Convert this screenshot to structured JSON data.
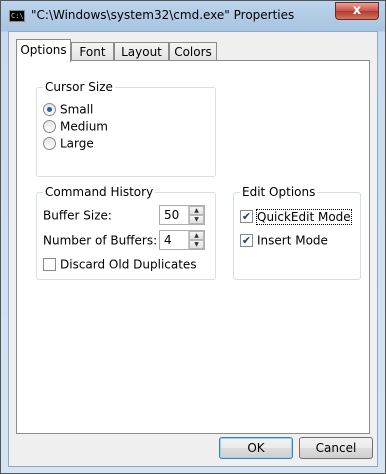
{
  "window": {
    "title": "\"C:\\Windows\\system32\\cmd.exe\" Properties",
    "app_icon_text": "C:\\",
    "close_glyph": "x"
  },
  "tabs": [
    {
      "label": "Options",
      "active": true
    },
    {
      "label": "Font",
      "active": false
    },
    {
      "label": "Layout",
      "active": false
    },
    {
      "label": "Colors",
      "active": false
    }
  ],
  "cursor_size": {
    "legend": "Cursor Size",
    "options": [
      {
        "label": "Small",
        "checked": true
      },
      {
        "label": "Medium",
        "checked": false
      },
      {
        "label": "Large",
        "checked": false
      }
    ]
  },
  "command_history": {
    "legend": "Command History",
    "buffer_size_label": "Buffer Size:",
    "buffer_size_value": "50",
    "num_buffers_label": "Number of Buffers:",
    "num_buffers_value": "4",
    "discard_label": "Discard Old Duplicates",
    "discard_checked": false
  },
  "edit_options": {
    "legend": "Edit Options",
    "quickedit_label": "QuickEdit Mode",
    "quickedit_checked": true,
    "insert_label": "Insert Mode",
    "insert_checked": true
  },
  "buttons": {
    "ok": "OK",
    "cancel": "Cancel"
  }
}
